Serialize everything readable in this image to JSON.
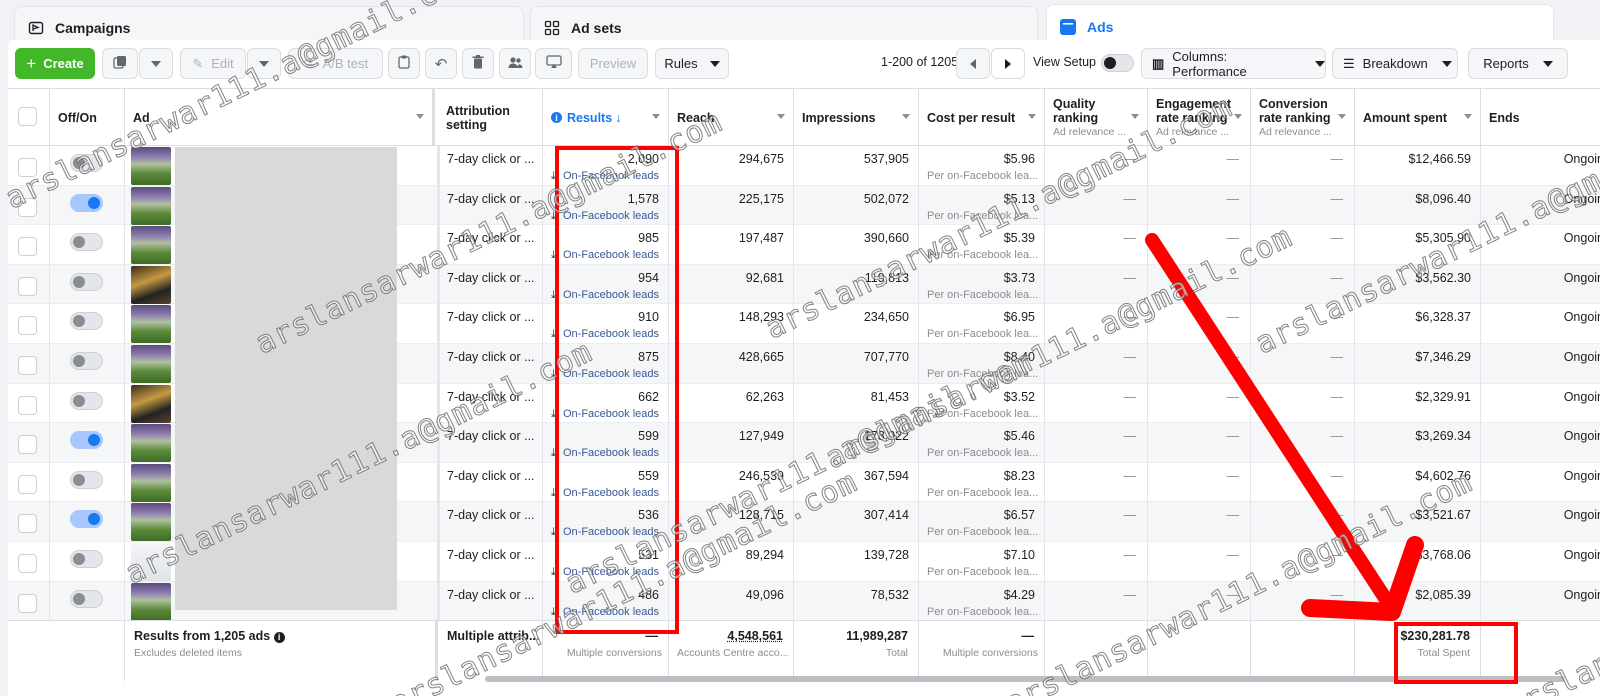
{
  "tabs": {
    "campaigns": "Campaigns",
    "adsets": "Ad sets",
    "ads": "Ads"
  },
  "toolbar": {
    "create": "Create",
    "edit": "Edit",
    "abtest": "A/B test",
    "preview": "Preview",
    "rules": "Rules",
    "pager": "1-200 of 1205",
    "view_setup": "View Setup",
    "columns": "Columns: Performance",
    "breakdown": "Breakdown",
    "reports": "Reports"
  },
  "headers": {
    "offon": "Off/On",
    "ad": "Ad",
    "attribution": "Attribution setting",
    "results": "Results",
    "reach": "Reach",
    "impressions": "Impressions",
    "cpr": "Cost per result",
    "quality": "Quality ranking",
    "quality_sub": "Ad relevance ...",
    "engagement": "Engagement rate ranking",
    "engagement_sub": "Ad relevance ...",
    "conversion": "Conversion rate ranking",
    "conversion_sub": "Ad relevance ...",
    "amount": "Amount spent",
    "ends": "Ends"
  },
  "rows": [
    {
      "on": false,
      "thumb": "green",
      "attr": "7-day click or ...",
      "results": "2,090",
      "result_type": "On-Facebook leads",
      "reach": "294,675",
      "impr": "537,905",
      "cpr": "$5.96",
      "cpr_sub": "Per on-Facebook lea...",
      "amount": "$12,466.59",
      "ends": "Ongoin"
    },
    {
      "on": true,
      "thumb": "green",
      "attr": "7-day click or ...",
      "results": "1,578",
      "result_type": "On-Facebook leads",
      "reach": "225,175",
      "impr": "502,072",
      "cpr": "$5.13",
      "cpr_sub": "Per on-Facebook lea...",
      "amount": "$8,096.40",
      "ends": "Ongoin"
    },
    {
      "on": false,
      "thumb": "green",
      "attr": "7-day click or ...",
      "results": "985",
      "result_type": "On-Facebook leads",
      "reach": "197,487",
      "impr": "390,660",
      "cpr": "$5.39",
      "cpr_sub": "Per on-Facebook lea...",
      "amount": "$5,305.90",
      "ends": "Ongoin"
    },
    {
      "on": false,
      "thumb": "dark",
      "attr": "7-day click or ...",
      "results": "954",
      "result_type": "On-Facebook leads",
      "reach": "92,681",
      "impr": "119,813",
      "cpr": "$3.73",
      "cpr_sub": "Per on-Facebook lea...",
      "amount": "$3,562.30",
      "ends": "Ongoin"
    },
    {
      "on": false,
      "thumb": "green",
      "attr": "7-day click or ...",
      "results": "910",
      "result_type": "On-Facebook leads",
      "reach": "148,293",
      "impr": "234,650",
      "cpr": "$6.95",
      "cpr_sub": "Per on-Facebook lea...",
      "amount": "$6,328.37",
      "ends": "Ongoin"
    },
    {
      "on": false,
      "thumb": "green",
      "attr": "7-day click or ...",
      "results": "875",
      "result_type": "On-Facebook leads",
      "reach": "428,665",
      "impr": "707,770",
      "cpr": "$8.40",
      "cpr_sub": "Per on-Facebook lea...",
      "amount": "$7,346.29",
      "ends": "Ongoin"
    },
    {
      "on": false,
      "thumb": "dark",
      "attr": "7-day click or ...",
      "results": "662",
      "result_type": "On-Facebook leads",
      "reach": "62,263",
      "impr": "81,453",
      "cpr": "$3.52",
      "cpr_sub": "Per on-Facebook lea...",
      "amount": "$2,329.91",
      "ends": "Ongoin"
    },
    {
      "on": true,
      "thumb": "green",
      "attr": "7-day click or ...",
      "results": "599",
      "result_type": "On-Facebook leads",
      "reach": "127,949",
      "impr": "178,022",
      "cpr": "$5.46",
      "cpr_sub": "Per on-Facebook lea...",
      "amount": "$3,269.34",
      "ends": "Ongoin"
    },
    {
      "on": false,
      "thumb": "green",
      "attr": "7-day click or ...",
      "results": "559",
      "result_type": "On-Facebook leads",
      "reach": "246,539",
      "impr": "367,594",
      "cpr": "$8.23",
      "cpr_sub": "Per on-Facebook lea...",
      "amount": "$4,602.76",
      "ends": "Ongoin"
    },
    {
      "on": true,
      "thumb": "green",
      "attr": "7-day click or ...",
      "results": "536",
      "result_type": "On-Facebook leads",
      "reach": "128,715",
      "impr": "307,414",
      "cpr": "$6.57",
      "cpr_sub": "Per on-Facebook lea...",
      "amount": "$3,521.67",
      "ends": "Ongoin"
    },
    {
      "on": false,
      "thumb": "light",
      "attr": "7-day click or ...",
      "results": "531",
      "result_type": "On-Facebook leads",
      "reach": "89,294",
      "impr": "139,728",
      "cpr": "$7.10",
      "cpr_sub": "Per on-Facebook lea...",
      "amount": "$3,768.06",
      "ends": "Ongoin"
    },
    {
      "on": false,
      "thumb": "green",
      "attr": "7-day click or ...",
      "results": "486",
      "result_type": "On-Facebook leads",
      "reach": "49,096",
      "impr": "78,532",
      "cpr": "$4.29",
      "cpr_sub": "Per on-Facebook lea...",
      "amount": "$2,085.39",
      "ends": "Ongoin"
    }
  ],
  "footer": {
    "title": "Results from 1,205 ads",
    "title_sub": "Excludes deleted items",
    "attr": "Multiple attrib...",
    "results": "—",
    "results_sub": "Multiple conversions",
    "reach": "4,548,561",
    "reach_sub": "Accounts Centre acco...",
    "impr": "11,989,287",
    "impr_sub": "Total",
    "cpr": "—",
    "cpr_sub": "Multiple conversions",
    "amount": "$230,281.78",
    "amount_sub": "Total Spent"
  },
  "dash": "—",
  "watermark": "arslansarwar111.a@gmail.com",
  "colors": {
    "accent": "#1877f2",
    "annotation": "#ff0000",
    "create": "#42b72a"
  }
}
